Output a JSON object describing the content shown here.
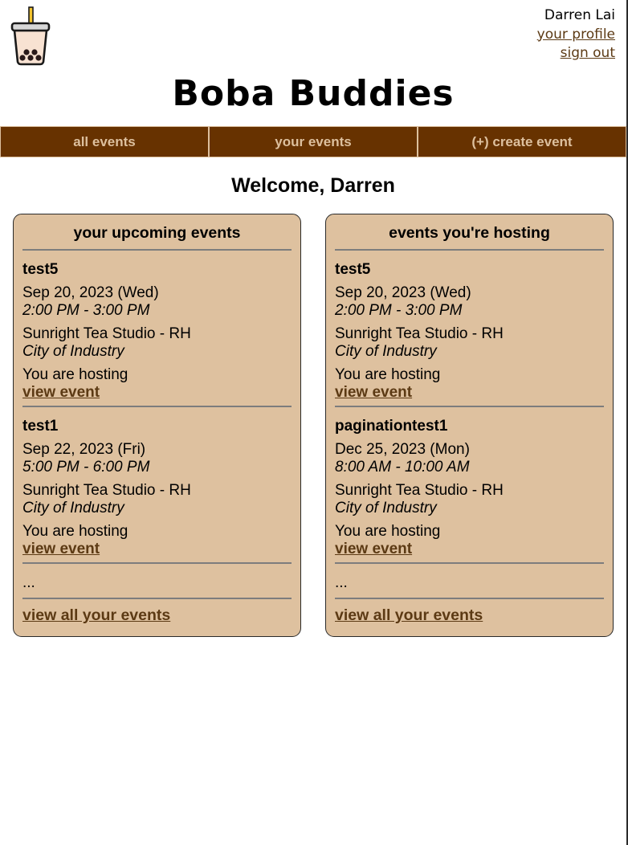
{
  "header": {
    "site_title": "Boba Buddies",
    "user_name": "Darren Lai",
    "profile_link": "your profile",
    "signout_link": "sign out",
    "logo_icon": "boba-tea-cup-icon"
  },
  "nav": {
    "items": [
      {
        "label": "all events"
      },
      {
        "label": "your events"
      },
      {
        "label": "(+) create event"
      }
    ]
  },
  "welcome": "Welcome, Darren",
  "upcoming": {
    "title": "your upcoming events",
    "events": [
      {
        "name": "test5",
        "date": "Sep 20, 2023 (Wed)",
        "time": "2:00 PM - 3:00 PM",
        "location": "Sunright Tea Studio - RH",
        "city": "City of Industry",
        "status": "You are hosting",
        "link": "view event"
      },
      {
        "name": "test1",
        "date": "Sep 22, 2023 (Fri)",
        "time": "5:00 PM - 6:00 PM",
        "location": "Sunright Tea Studio - RH",
        "city": "City of Industry",
        "status": "You are hosting",
        "link": "view event"
      }
    ],
    "ellipsis": "...",
    "view_all": "view all your events"
  },
  "hosting": {
    "title": "events you're hosting",
    "events": [
      {
        "name": "test5",
        "date": "Sep 20, 2023 (Wed)",
        "time": "2:00 PM - 3:00 PM",
        "location": "Sunright Tea Studio - RH",
        "city": "City of Industry",
        "status": "You are hosting",
        "link": "view event"
      },
      {
        "name": "paginationtest1",
        "date": "Dec 25, 2023 (Mon)",
        "time": "8:00 AM - 10:00 AM",
        "location": "Sunright Tea Studio - RH",
        "city": "City of Industry",
        "status": "You are hosting",
        "link": "view event"
      }
    ],
    "ellipsis": "...",
    "view_all": "view all your events"
  },
  "colors": {
    "nav_bg": "#673200",
    "nav_text": "#ddc09e",
    "card_bg": "#dec19f",
    "link": "#5c3a14"
  }
}
